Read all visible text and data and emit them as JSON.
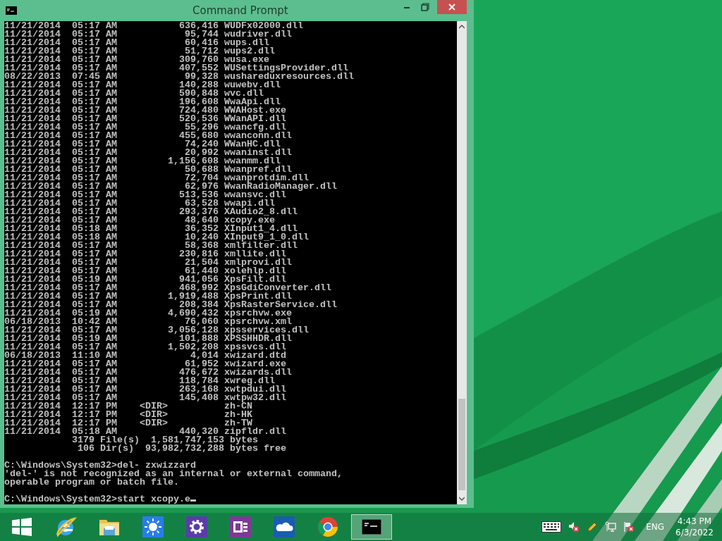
{
  "window": {
    "title": "Command Prompt"
  },
  "console": {
    "rows": [
      {
        "date": "11/21/2014",
        "time": "05:17 AM",
        "size": "636,416",
        "name": "WUDFx02000.dll"
      },
      {
        "date": "11/21/2014",
        "time": "05:17 AM",
        "size": "95,744",
        "name": "wudriver.dll"
      },
      {
        "date": "11/21/2014",
        "time": "05:17 AM",
        "size": "60,416",
        "name": "wups.dll"
      },
      {
        "date": "11/21/2014",
        "time": "05:17 AM",
        "size": "51,712",
        "name": "wups2.dll"
      },
      {
        "date": "11/21/2014",
        "time": "05:17 AM",
        "size": "309,760",
        "name": "wusa.exe"
      },
      {
        "date": "11/21/2014",
        "time": "05:17 AM",
        "size": "407,552",
        "name": "WUSettingsProvider.dll"
      },
      {
        "date": "08/22/2013",
        "time": "07:45 AM",
        "size": "99,328",
        "name": "wushareduxresources.dll"
      },
      {
        "date": "11/21/2014",
        "time": "05:17 AM",
        "size": "140,288",
        "name": "wuwebv.dll"
      },
      {
        "date": "11/21/2014",
        "time": "05:17 AM",
        "size": "590,848",
        "name": "wvc.dll"
      },
      {
        "date": "11/21/2014",
        "time": "05:17 AM",
        "size": "196,608",
        "name": "WwaApi.dll"
      },
      {
        "date": "11/21/2014",
        "time": "05:17 AM",
        "size": "724,480",
        "name": "WWAHost.exe"
      },
      {
        "date": "11/21/2014",
        "time": "05:17 AM",
        "size": "520,536",
        "name": "WWanAPI.dll"
      },
      {
        "date": "11/21/2014",
        "time": "05:17 AM",
        "size": "55,296",
        "name": "wwancfg.dll"
      },
      {
        "date": "11/21/2014",
        "time": "05:17 AM",
        "size": "455,680",
        "name": "wwanconn.dll"
      },
      {
        "date": "11/21/2014",
        "time": "05:17 AM",
        "size": "74,240",
        "name": "WWanHC.dll"
      },
      {
        "date": "11/21/2014",
        "time": "05:17 AM",
        "size": "20,992",
        "name": "wwaninst.dll"
      },
      {
        "date": "11/21/2014",
        "time": "05:17 AM",
        "size": "1,156,608",
        "name": "wwanmm.dll"
      },
      {
        "date": "11/21/2014",
        "time": "05:17 AM",
        "size": "50,688",
        "name": "Wwanpref.dll"
      },
      {
        "date": "11/21/2014",
        "time": "05:17 AM",
        "size": "72,704",
        "name": "wwanprotdim.dll"
      },
      {
        "date": "11/21/2014",
        "time": "05:17 AM",
        "size": "62,976",
        "name": "WwanRadioManager.dll"
      },
      {
        "date": "11/21/2014",
        "time": "05:17 AM",
        "size": "513,536",
        "name": "wwansvc.dll"
      },
      {
        "date": "11/21/2014",
        "time": "05:17 AM",
        "size": "63,528",
        "name": "wwapi.dll"
      },
      {
        "date": "11/21/2014",
        "time": "05:17 AM",
        "size": "293,376",
        "name": "XAudio2_8.dll"
      },
      {
        "date": "11/21/2014",
        "time": "05:17 AM",
        "size": "48,640",
        "name": "xcopy.exe"
      },
      {
        "date": "11/21/2014",
        "time": "05:18 AM",
        "size": "36,352",
        "name": "XInput1_4.dll"
      },
      {
        "date": "11/21/2014",
        "time": "05:18 AM",
        "size": "10,240",
        "name": "XInput9_1_0.dll"
      },
      {
        "date": "11/21/2014",
        "time": "05:17 AM",
        "size": "58,368",
        "name": "xmlfilter.dll"
      },
      {
        "date": "11/21/2014",
        "time": "05:17 AM",
        "size": "230,816",
        "name": "xmllite.dll"
      },
      {
        "date": "11/21/2014",
        "time": "05:17 AM",
        "size": "21,504",
        "name": "xmlprovi.dll"
      },
      {
        "date": "11/21/2014",
        "time": "05:17 AM",
        "size": "61,440",
        "name": "xolehlp.dll"
      },
      {
        "date": "11/21/2014",
        "time": "05:19 AM",
        "size": "941,056",
        "name": "XpsFilt.dll"
      },
      {
        "date": "11/21/2014",
        "time": "05:17 AM",
        "size": "468,992",
        "name": "XpsGdiConverter.dll"
      },
      {
        "date": "11/21/2014",
        "time": "05:17 AM",
        "size": "1,919,488",
        "name": "XpsPrint.dll"
      },
      {
        "date": "11/21/2014",
        "time": "05:17 AM",
        "size": "208,384",
        "name": "XpsRasterService.dll"
      },
      {
        "date": "11/21/2014",
        "time": "05:19 AM",
        "size": "4,690,432",
        "name": "xpsrchvw.exe"
      },
      {
        "date": "06/18/2013",
        "time": "10:42 AM",
        "size": "76,060",
        "name": "xpsrchvw.xml"
      },
      {
        "date": "11/21/2014",
        "time": "05:17 AM",
        "size": "3,056,128",
        "name": "xpsservices.dll"
      },
      {
        "date": "11/21/2014",
        "time": "05:19 AM",
        "size": "101,888",
        "name": "XPSSHHDR.dll"
      },
      {
        "date": "11/21/2014",
        "time": "05:17 AM",
        "size": "1,502,208",
        "name": "xpssvcs.dll"
      },
      {
        "date": "06/18/2013",
        "time": "11:10 AM",
        "size": "4,014",
        "name": "xwizard.dtd"
      },
      {
        "date": "11/21/2014",
        "time": "05:17 AM",
        "size": "61,952",
        "name": "xwizard.exe"
      },
      {
        "date": "11/21/2014",
        "time": "05:17 AM",
        "size": "476,672",
        "name": "xwizards.dll"
      },
      {
        "date": "11/21/2014",
        "time": "05:17 AM",
        "size": "118,784",
        "name": "xwreg.dll"
      },
      {
        "date": "11/21/2014",
        "time": "05:17 AM",
        "size": "263,168",
        "name": "xwtpdui.dll"
      },
      {
        "date": "11/21/2014",
        "time": "05:17 AM",
        "size": "145,408",
        "name": "xwtpw32.dll"
      },
      {
        "date": "11/21/2014",
        "time": "12:17 PM",
        "dir": "<DIR>",
        "name": "zh-CN"
      },
      {
        "date": "11/21/2014",
        "time": "12:17 PM",
        "dir": "<DIR>",
        "name": "zh-HK"
      },
      {
        "date": "11/21/2014",
        "time": "12:17 PM",
        "dir": "<DIR>",
        "name": "zh-TW"
      },
      {
        "date": "11/21/2014",
        "time": "05:18 AM",
        "size": "440,320",
        "name": "zipfldr.dll"
      }
    ],
    "summary": [
      {
        "count": "3179",
        "label": "File(s)",
        "bytes": "1,581,747,153",
        "unit": "bytes"
      },
      {
        "count": "106",
        "label": "Dir(s)",
        "bytes": "93,982,732,288",
        "unit": "bytes free"
      }
    ],
    "sessions": [
      {
        "command": "C:\\Windows\\System32>del- zxwizzard",
        "output": [
          "'del-' is not recognized as an internal or external command,",
          "operable program or batch file."
        ],
        "cursor": false
      },
      {
        "command": "C:\\Windows\\System32>start xcopy.e",
        "cursor": true
      }
    ]
  },
  "taskbar": {
    "items": [
      {
        "kind": "start",
        "selected": false
      },
      {
        "kind": "browser",
        "selected": false
      },
      {
        "kind": "folder",
        "selected": false
      },
      {
        "kind": "weather",
        "selected": false
      },
      {
        "kind": "settings",
        "selected": false
      },
      {
        "kind": "notes",
        "selected": false
      },
      {
        "kind": "cloud",
        "selected": false
      },
      {
        "kind": "ring",
        "selected": false
      },
      {
        "kind": "terminal",
        "selected": true
      }
    ],
    "tray": {
      "icons": [
        {
          "kind": "keyboard"
        },
        {
          "kind": "speaker-muted"
        },
        {
          "kind": "pen"
        },
        {
          "kind": "network"
        },
        {
          "kind": "flag"
        }
      ],
      "language": "ENG",
      "time": "4:43 PM",
      "date": "6/3/2022"
    }
  }
}
